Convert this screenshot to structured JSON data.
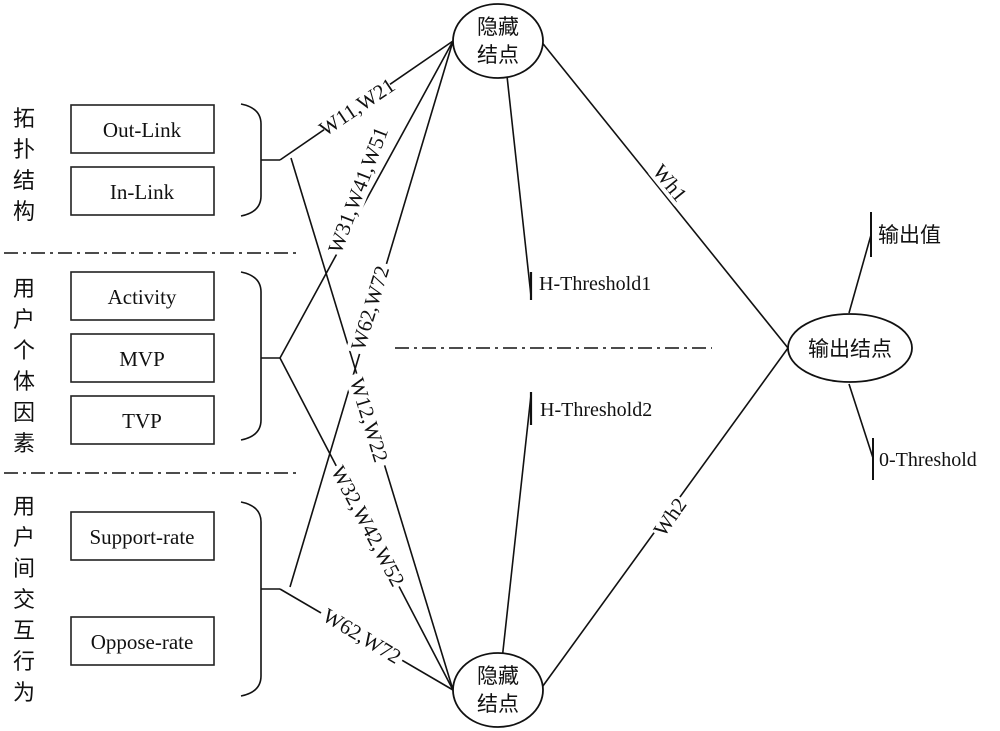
{
  "diagram": {
    "type": "neural-network",
    "groups": [
      {
        "id": "topology",
        "label": "拓扑结构",
        "inputs": [
          "Out-Link",
          "In-Link"
        ]
      },
      {
        "id": "individual",
        "label": "用户个体因素",
        "inputs": [
          "Activity",
          "MVP",
          "TVP"
        ]
      },
      {
        "id": "interaction",
        "label": "用户间交互行为",
        "inputs": [
          "Support-rate",
          "Oppose-rate"
        ]
      }
    ],
    "hidden_nodes": [
      {
        "id": "hidden1",
        "label_line1": "隐藏",
        "label_line2": "结点",
        "threshold": "H-Threshold1"
      },
      {
        "id": "hidden2",
        "label_line1": "隐藏",
        "label_line2": "结点",
        "threshold": "H-Threshold2"
      }
    ],
    "output_node": {
      "label": "输出结点",
      "value_label": "输出值",
      "threshold": "0-Threshold"
    },
    "edge_labels": {
      "topology_to_h1": "W11,W21",
      "topology_to_h2": "W12,W22",
      "individual_to_h1": "W31,W41,W51",
      "individual_to_h2": "W32,W42,W52",
      "interaction_to_h1": "W62,W72",
      "interaction_to_h2": "W62,W72",
      "h1_to_output": "Wh1",
      "h2_to_output": "Wh2"
    }
  }
}
